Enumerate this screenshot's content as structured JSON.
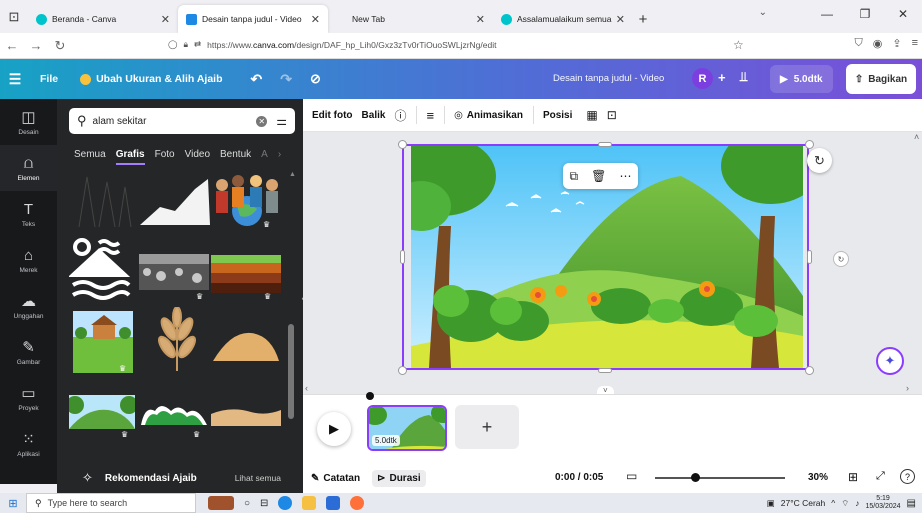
{
  "browser": {
    "tabs": [
      {
        "label": "Beranda - Canva",
        "color": "#00c4cc",
        "active": false
      },
      {
        "label": "Desain tanpa judul - Video",
        "color": "#1e88e5",
        "active": true
      },
      {
        "label": "New Tab",
        "color": "",
        "active": false
      },
      {
        "label": "Assalamualaikum semua Salam",
        "color": "#00c4cc",
        "active": false
      }
    ],
    "url_prefix": "https://www.",
    "url_host": "canva.com",
    "url_path": "/design/DAF_hp_Lih0/Gxz3zTv0rTiOuoSWLjzrNg/edit"
  },
  "header": {
    "file_label": "File",
    "resize_label": "Ubah Ukuran & Alih Ajaib",
    "doc_title": "Desain tanpa judul - Video",
    "avatar_initial": "R",
    "duration_label": "5.0dtk",
    "share_label": "Bagikan"
  },
  "rail": [
    {
      "label": "Desain",
      "icon": "layout-icon"
    },
    {
      "label": "Elemen",
      "icon": "elements-icon"
    },
    {
      "label": "Teks",
      "icon": "text-icon"
    },
    {
      "label": "Merek",
      "icon": "brand-icon"
    },
    {
      "label": "Unggahan",
      "icon": "upload-icon"
    },
    {
      "label": "Gambar",
      "icon": "draw-icon"
    },
    {
      "label": "Proyek",
      "icon": "folder-icon"
    },
    {
      "label": "Aplikasi",
      "icon": "apps-icon"
    }
  ],
  "panel": {
    "search_value": "alam sekitar",
    "tabs": [
      "Semua",
      "Grafis",
      "Foto",
      "Video",
      "Bentuk",
      "A"
    ],
    "active_tab": "Grafis",
    "recommend_label": "Rekomendasi Ajaib",
    "see_all_label": "Lihat semua"
  },
  "toolbar": {
    "edit_photo": "Edit foto",
    "flip": "Balik",
    "animate": "Animasikan",
    "position": "Posisi"
  },
  "timeline": {
    "clip_duration": "5.0dtk"
  },
  "bottombar": {
    "notes_label": "Catatan",
    "duration_label": "Durasi",
    "time": "0:00 / 0:05",
    "zoom": "30%",
    "zoom_fraction": 0.3
  },
  "taskbar": {
    "search_placeholder": "Type here to search",
    "weather": "27°C Cerah",
    "time": "5:19",
    "date": "15/03/2024"
  },
  "colors": {
    "accent": "#8b3dff",
    "panel_bg": "#252627",
    "rail_bg": "#18191b"
  }
}
